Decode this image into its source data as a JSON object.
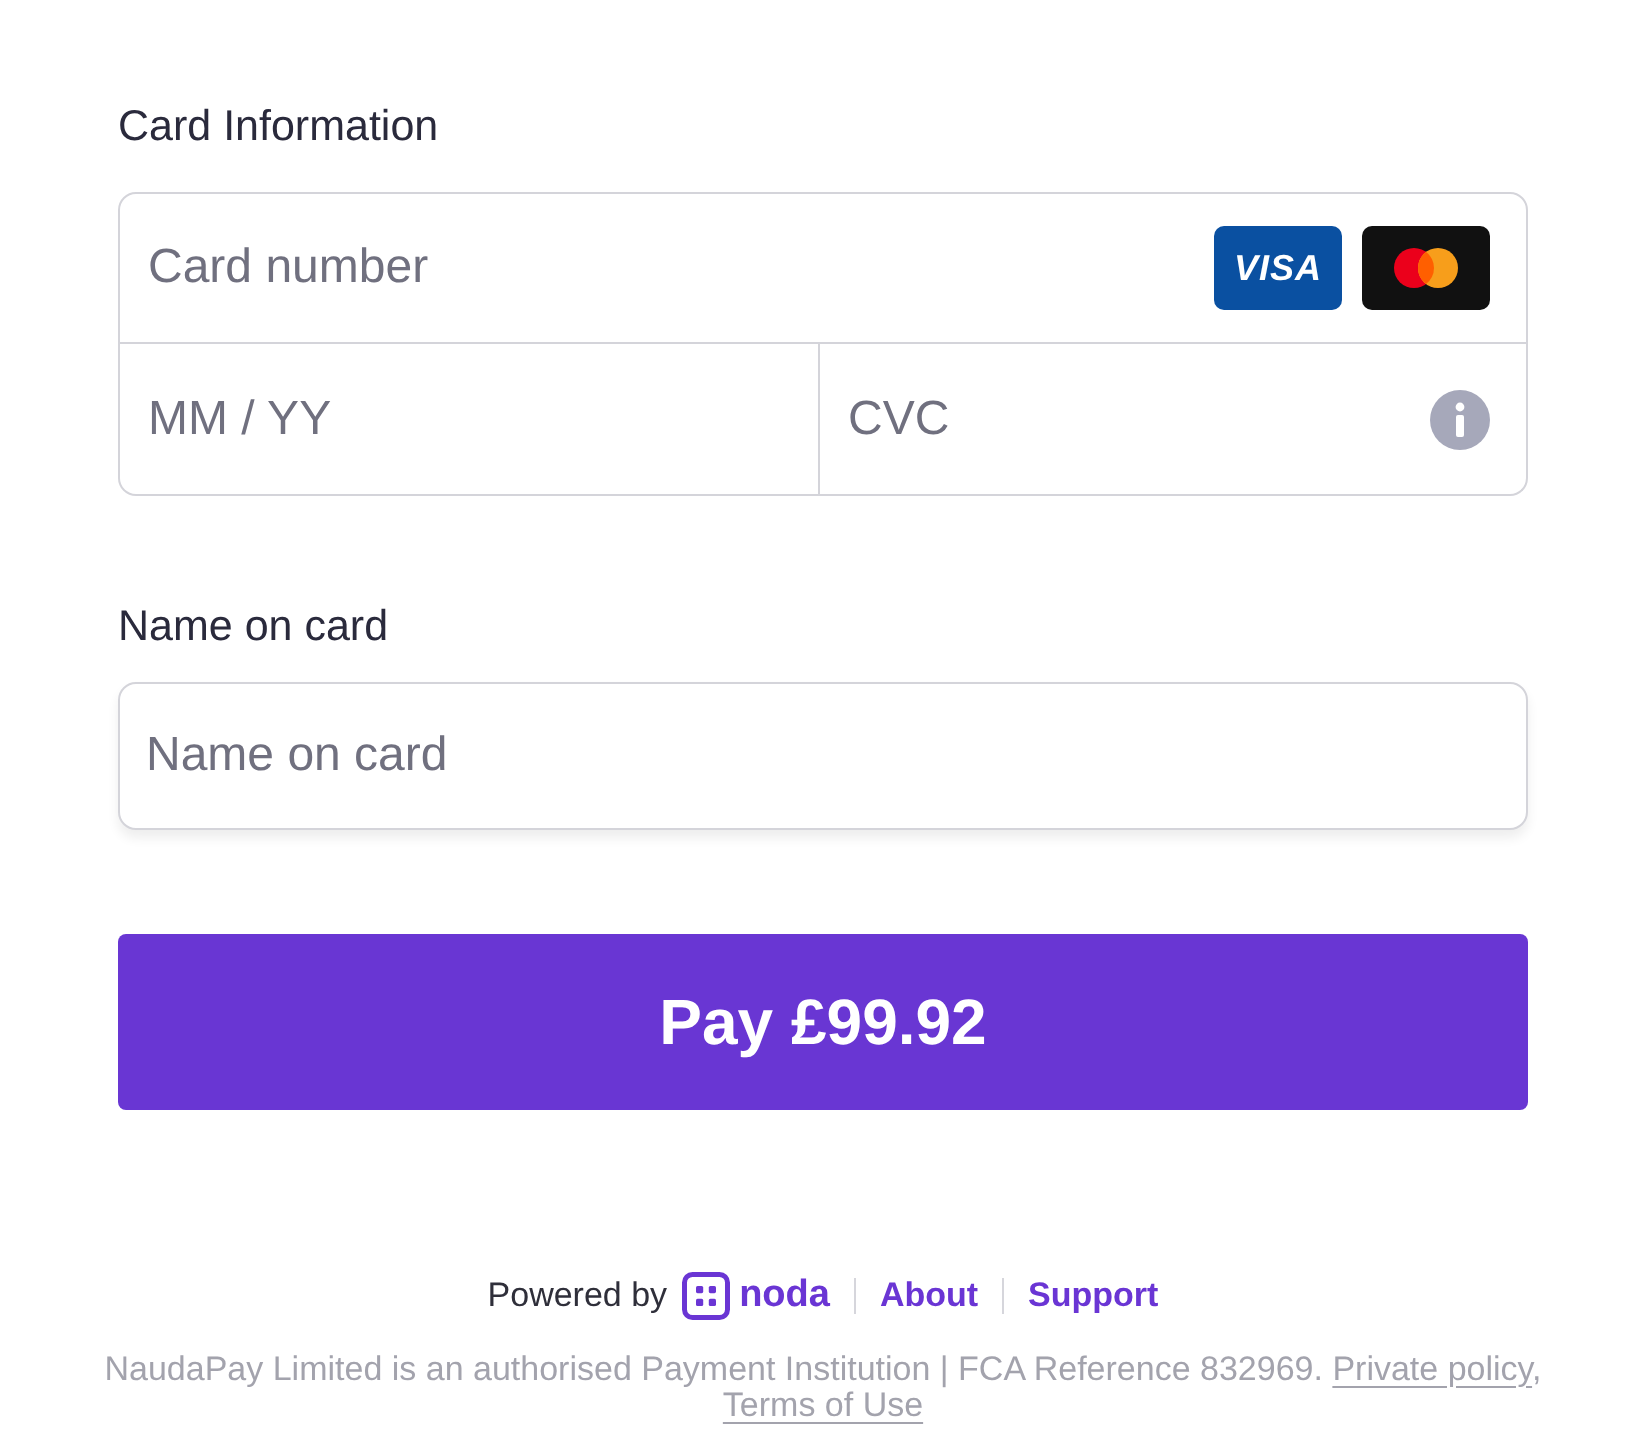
{
  "card_information": {
    "label": "Card Information",
    "card_number": {
      "placeholder": "Card number"
    },
    "card_brands": [
      {
        "kind": "visa",
        "text": "VISA"
      },
      {
        "kind": "mastercard"
      }
    ],
    "expiry": {
      "placeholder": "MM / YY"
    },
    "cvc": {
      "placeholder": "CVC"
    }
  },
  "name_on_card": {
    "label": "Name on card",
    "placeholder": "Name on card"
  },
  "pay_button": {
    "label": "Pay £99.92"
  },
  "footer": {
    "powered_by": "Powered by",
    "brand": "noda",
    "links": [
      "About",
      "Support"
    ],
    "legal": {
      "text": "NaudaPay Limited is an authorised Payment Institution | FCA Reference 832969.",
      "links": [
        "Private policy",
        "Terms of Use"
      ],
      "link_separator": ","
    }
  }
}
